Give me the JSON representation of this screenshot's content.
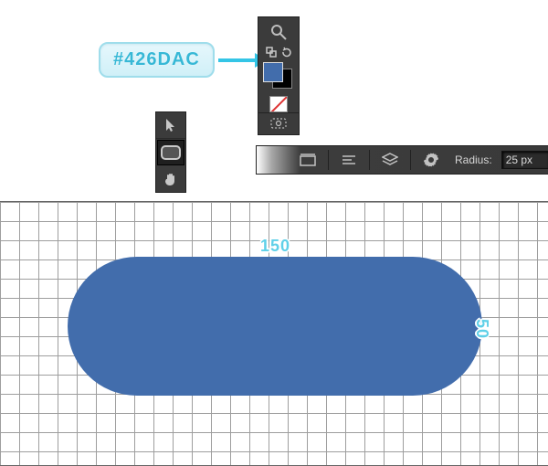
{
  "callout": {
    "hex": "#426DAC"
  },
  "swatch": {
    "foreground": "#426DAC",
    "background": "#000000"
  },
  "tools": {
    "move": "move-tool",
    "shape": "rounded-rectangle-tool",
    "hand": "hand-tool"
  },
  "options": {
    "radius_label": "Radius:",
    "radius_value": "25 px"
  },
  "canvas": {
    "width_label": "150",
    "height_label": "50"
  }
}
